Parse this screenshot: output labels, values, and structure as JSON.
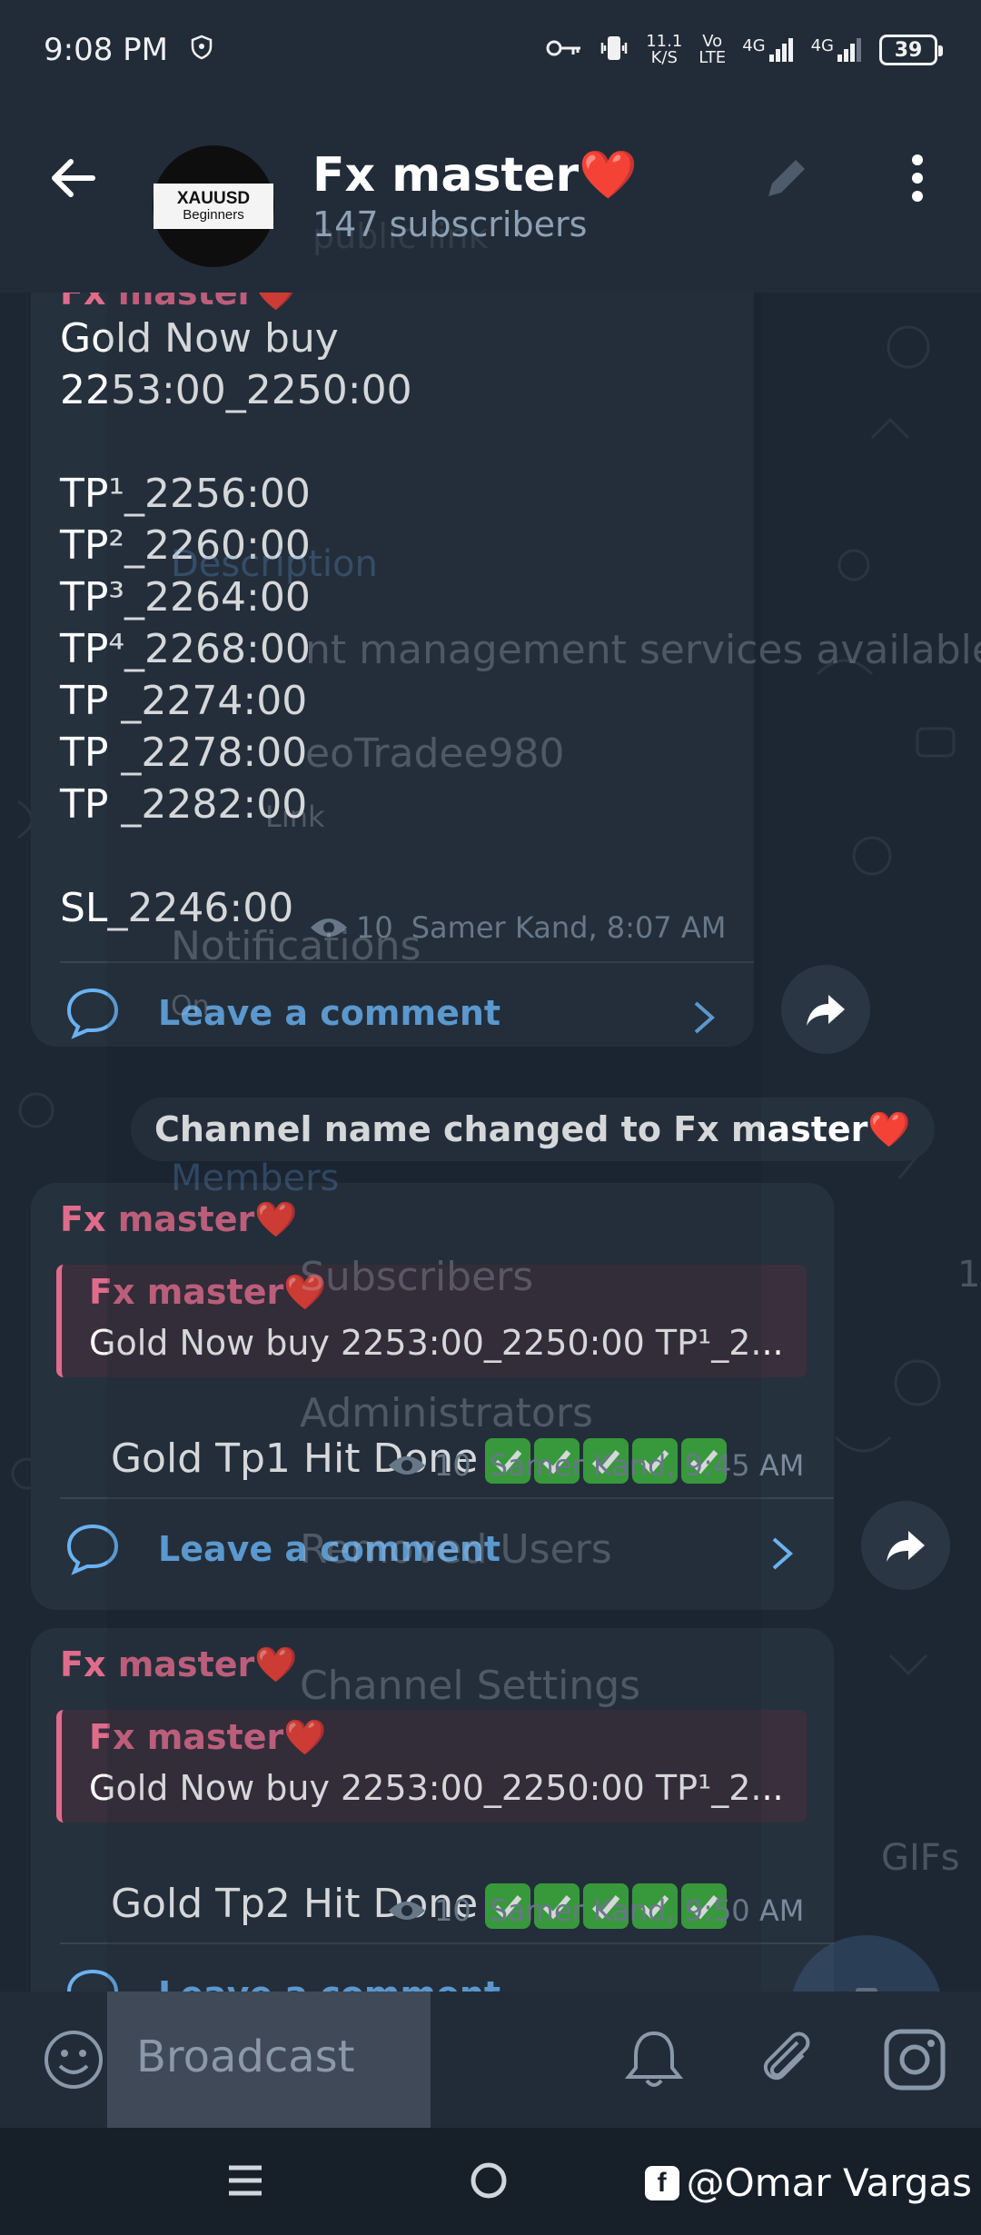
{
  "status": {
    "time": "9:08 PM",
    "net_speed_top": "11.1",
    "net_speed_bottom": "K/S",
    "volte_top": "Vo",
    "volte_bottom": "LTE",
    "sig1": "4G",
    "sig2": "4G",
    "battery": "39"
  },
  "header": {
    "title": "Fx master❤️",
    "subtitle": "147 subscribers",
    "ghost_subtitle": "public link",
    "avatar_line1": "XAUUSD",
    "avatar_line2": "Beginners"
  },
  "messages": {
    "m1": {
      "sender_partial": "Fx master❤️",
      "text": "Gold Now buy\n2253:00_2250:00\n\nTP¹_2256:00\nTP²_2260:00\nTP³_2264:00\nTP⁴_2268:00\nTP _2274:00\nTP _2278:00\nTP _2282:00\n\nSL_2246:00",
      "views": "10",
      "author_time": "Samer Kand, 8:07 AM",
      "comment": "Leave a comment"
    },
    "service": "Channel name changed to Fx master❤️",
    "m2": {
      "sender": "Fx master❤️",
      "reply_name": "Fx master❤️",
      "reply_text": "Gold Now buy  2253:00_2250:00  TP¹_2...",
      "text": "Gold Tp1 Hit Done",
      "views": "10",
      "author_time": "Samer Kand, 9:45 AM",
      "comment": "Leave a comment"
    },
    "m3": {
      "sender": "Fx master❤️",
      "reply_name": "Fx master❤️",
      "reply_text": "Gold Now buy  2253:00_2250:00  TP¹_2...",
      "text": "Gold Tp2 Hit Done",
      "views": "10",
      "author_time": "Samer Kand, 9:50 AM",
      "comment": "Leave a comment"
    }
  },
  "ghost_overlay": {
    "description": "Description",
    "desc_text": "nt management services available",
    "username": "eoTradee980",
    "link": "Link",
    "notifications": "Notifications",
    "on": "On",
    "members": "Members",
    "subscribers": "Subscribers",
    "administrators": "Administrators",
    "removed": "Removed Users",
    "settings": "Channel Settings",
    "gifs": "GIFs",
    "one": "1"
  },
  "input": {
    "placeholder": "Broadcast"
  },
  "watermark": "@Omar Vargas"
}
